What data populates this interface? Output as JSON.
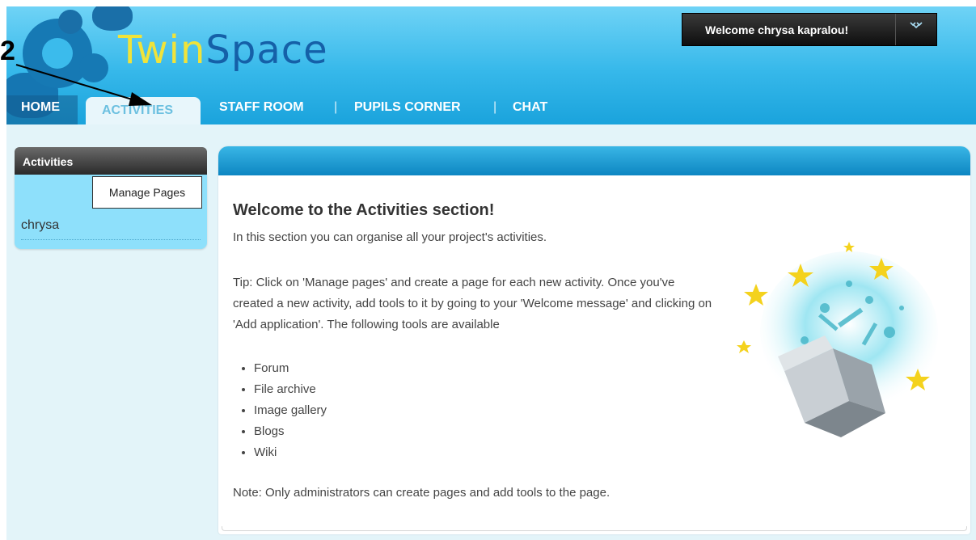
{
  "header": {
    "logo_twin": "Twin",
    "logo_space": "Space",
    "welcome_text": "Welcome chrysa kapralou!",
    "welcome_menu_icon": "dropdown-chevron-icon"
  },
  "nav": {
    "home": "HOME",
    "activities": "ACTIVITIES",
    "staff_room": "STAFF ROOM",
    "pupils_corner": "PUPILS CORNER",
    "chat": "CHAT",
    "separator": "|"
  },
  "sidebar": {
    "title": "Activities",
    "manage_pages": "Manage Pages",
    "user": "chrysa"
  },
  "main": {
    "heading": "Welcome to the Activities section!",
    "intro": "In this section you can organise all your project's activities.",
    "tip": "Tip: Click on 'Manage pages' and create a page for each new activity. Once you've created a new activity, add tools to it by going to your 'Welcome message' and clicking on 'Add application'. The following tools are available",
    "tools": [
      "Forum",
      "File archive",
      "Image gallery",
      "Blogs",
      "Wiki"
    ],
    "note": "Note: Only administrators can create pages and add tools to the page."
  },
  "annotation": {
    "number": "2"
  },
  "colors": {
    "header_blue": "#36b8ea",
    "logo_yellow": "#f0e33a",
    "logo_blue": "#1560a8",
    "main_bar_blue": "#0d86c2",
    "sidebar_cyan": "#8ee0fb"
  }
}
